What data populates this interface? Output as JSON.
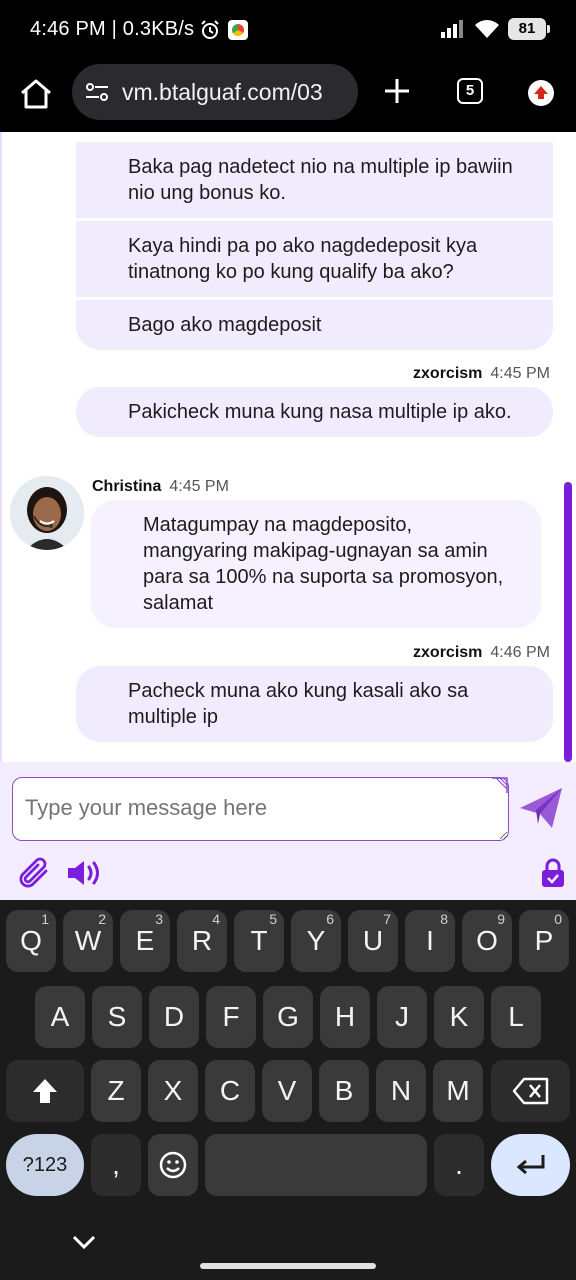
{
  "status_bar": {
    "time_network": "4:46 PM | 0.3KB/s",
    "battery": "81"
  },
  "browser": {
    "url": "vm.btalguaf.com/03",
    "tab_count": "5"
  },
  "chat": {
    "user_group_top": [
      "Baka pag nadetect nio na multiple ip bawiin nio ung bonus ko.",
      "Kaya hindi pa po ako nagdedeposit kya tinatnong ko po kung qualify ba ako?",
      "Bago ako magdeposit"
    ],
    "msg2": {
      "name": "zxorcism",
      "time": "4:45 PM",
      "text": "Pakicheck muna kung nasa multiple ip ako."
    },
    "agent_msg": {
      "name": "Christina",
      "time": "4:45 PM",
      "text": "Matagumpay na magdeposito, mangyaring makipag-ugnayan sa amin para sa 100% na suporta sa promosyon, salamat"
    },
    "msg3": {
      "name": "zxorcism",
      "time": "4:46 PM",
      "text": "Pacheck muna ako kung kasali ako sa multiple ip"
    }
  },
  "composer": {
    "placeholder": "Type your message here"
  },
  "keyboard": {
    "row1": [
      {
        "k": "Q",
        "h": "1"
      },
      {
        "k": "W",
        "h": "2"
      },
      {
        "k": "E",
        "h": "3"
      },
      {
        "k": "R",
        "h": "4"
      },
      {
        "k": "T",
        "h": "5"
      },
      {
        "k": "Y",
        "h": "6"
      },
      {
        "k": "U",
        "h": "7"
      },
      {
        "k": "I",
        "h": "8"
      },
      {
        "k": "O",
        "h": "9"
      },
      {
        "k": "P",
        "h": "0"
      }
    ],
    "row2": [
      "A",
      "S",
      "D",
      "F",
      "G",
      "H",
      "J",
      "K",
      "L"
    ],
    "row3": [
      "Z",
      "X",
      "C",
      "V",
      "B",
      "N",
      "M"
    ],
    "symbols_label": "?123",
    "comma": ",",
    "period": "."
  },
  "colors": {
    "accent": "#7a1ddc",
    "bubble": "#f1ebfe",
    "composer_bg": "#f4edff"
  }
}
